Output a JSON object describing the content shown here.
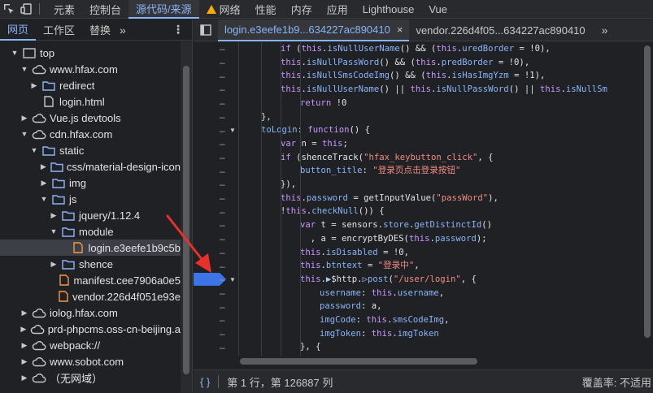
{
  "top_tabs": [
    {
      "label": "元素",
      "icon": null,
      "active": false
    },
    {
      "label": "控制台",
      "icon": null,
      "active": false
    },
    {
      "label": "源代码/来源",
      "icon": null,
      "active": true
    },
    {
      "label": "网络",
      "icon": "warning-icon",
      "active": false
    },
    {
      "label": "性能",
      "icon": null,
      "active": false
    },
    {
      "label": "内存",
      "icon": null,
      "active": false
    },
    {
      "label": "应用",
      "icon": null,
      "active": false
    },
    {
      "label": "Lighthouse",
      "icon": null,
      "active": false
    },
    {
      "label": "Vue",
      "icon": null,
      "active": false
    }
  ],
  "navigator": {
    "tabs": [
      {
        "label": "网页",
        "active": true
      },
      {
        "label": "工作区",
        "active": false
      },
      {
        "label": "替换",
        "active": false
      }
    ],
    "more": "»",
    "menu": "⋮",
    "tree": [
      {
        "label": "top",
        "depth": 0,
        "expand": "open",
        "icon": "frame-icon"
      },
      {
        "label": "www.hfax.com",
        "depth": 1,
        "expand": "open",
        "icon": "cloud-icon"
      },
      {
        "label": "redirect",
        "depth": 2,
        "expand": "closed",
        "icon": "folder-icon"
      },
      {
        "label": "login.html",
        "depth": 2,
        "expand": "none",
        "icon": "document-icon"
      },
      {
        "label": "Vue.js devtools",
        "depth": 1,
        "expand": "closed",
        "icon": "cloud-icon"
      },
      {
        "label": "cdn.hfax.com",
        "depth": 1,
        "expand": "open",
        "icon": "cloud-icon"
      },
      {
        "label": "static",
        "depth": 2,
        "expand": "open",
        "icon": "folder-icon"
      },
      {
        "label": "css/material-design-icon",
        "depth": 3,
        "expand": "closed",
        "icon": "folder-icon"
      },
      {
        "label": "img",
        "depth": 3,
        "expand": "closed",
        "icon": "folder-icon"
      },
      {
        "label": "js",
        "depth": 3,
        "expand": "open",
        "icon": "folder-icon"
      },
      {
        "label": "jquery/1.12.4",
        "depth": 4,
        "expand": "closed",
        "icon": "folder-icon"
      },
      {
        "label": "module",
        "depth": 4,
        "expand": "open",
        "icon": "folder-icon"
      },
      {
        "label": "login.e3eefe1b9c5b",
        "depth": 5,
        "expand": "none",
        "icon": "js-file-icon",
        "selected": true
      },
      {
        "label": "shence",
        "depth": 4,
        "expand": "closed",
        "icon": "folder-icon"
      },
      {
        "label": "manifest.cee7906a0e5",
        "depth": 4,
        "expand": "none",
        "icon": "js-file-icon"
      },
      {
        "label": "vendor.226d4f051e93e",
        "depth": 4,
        "expand": "none",
        "icon": "js-file-icon"
      },
      {
        "label": "iolog.hfax.com",
        "depth": 1,
        "expand": "closed",
        "icon": "cloud-icon"
      },
      {
        "label": "prd-phpcms.oss-cn-beijing.a",
        "depth": 1,
        "expand": "closed",
        "icon": "cloud-icon"
      },
      {
        "label": "webpack://",
        "depth": 1,
        "expand": "closed",
        "icon": "cloud-icon"
      },
      {
        "label": "www.sobot.com",
        "depth": 1,
        "expand": "closed",
        "icon": "cloud-icon"
      },
      {
        "label": "（无网域）",
        "depth": 1,
        "expand": "closed",
        "icon": "cloud-icon"
      }
    ]
  },
  "editor": {
    "tabs": [
      {
        "label": "login.e3eefe1b9...634227ac890410",
        "active": true,
        "closable": true
      },
      {
        "label": "vendor.226d4f05...634227ac890410",
        "active": false,
        "closable": false
      }
    ],
    "more": "»",
    "breakpoint_line": 17,
    "fold_lines": [
      6,
      17,
      23
    ],
    "lines": [
      {
        "indent": 2,
        "html": "<span class='k'>if</span> (<span class='k'>this</span>.<span class='p'>isNullUserName</span>() && (<span class='k'>this</span>.<span class='p'>uredBorder</span> = !0),"
      },
      {
        "indent": 2,
        "html": "<span class='k'>this</span>.<span class='p'>isNullPassWord</span>() && (<span class='k'>this</span>.<span class='p'>predBorder</span> = !0),"
      },
      {
        "indent": 2,
        "html": "<span class='k'>this</span>.<span class='p'>isNullSmsCodeImg</span>() && (<span class='k'>this</span>.<span class='p'>isHasImgYzm</span> = !1),"
      },
      {
        "indent": 2,
        "html": "<span class='k'>this</span>.<span class='p'>isNullUserName</span>() || <span class='k'>this</span>.<span class='p'>isNullPassWord</span>() || <span class='k'>this</span>.<span class='p'>isNullSm</span>"
      },
      {
        "indent": 3,
        "html": "<span class='k'>return</span> !0"
      },
      {
        "indent": 1,
        "html": "},"
      },
      {
        "indent": 1,
        "html": "<span class='p'>toLogin</span>: <span class='k'>function</span>() {"
      },
      {
        "indent": 2,
        "html": "<span class='k'>var</span> n = <span class='k'>this</span>;"
      },
      {
        "indent": 2,
        "html": "<span class='k'>if</span> (shenceTrack(<span class='s'>\"hfax_keybutton_click\"</span>, {"
      },
      {
        "indent": 3,
        "html": "<span class='p'>button_title</span>: <span class='s'>\"登录页点击登录按钮\"</span>"
      },
      {
        "indent": 2,
        "html": "}),"
      },
      {
        "indent": 2,
        "html": "<span class='k'>this</span>.<span class='p'>password</span> = getInputValue(<span class='s'>\"passWord\"</span>),"
      },
      {
        "indent": 2,
        "html": "!<span class='k'>this</span>.<span class='p'>checkNull</span>()) {"
      },
      {
        "indent": 3,
        "html": "<span class='k'>var</span> t = sensors.<span class='p'>store</span>.<span class='p'>getDistinctId</span>()"
      },
      {
        "indent": 3,
        "html": "  , a = encryptByDES(<span class='k'>this</span>.<span class='p'>password</span>);"
      },
      {
        "indent": 3,
        "html": "<span class='k'>this</span>.<span class='p'>isDisabled</span> = !0,"
      },
      {
        "indent": 3,
        "html": "<span class='k'>this</span>.<span class='p'>btntext</span> = <span class='s'>\"登录中\"</span>,"
      },
      {
        "indent": 3,
        "html": "<span class='k'>this</span>.<span class='n'>▶</span>$http.<span class='n'>▷</span><span class='p'>post</span>(<span class='s'>\"/user/login\"</span>, {"
      },
      {
        "indent": 4,
        "html": "<span class='p'>username</span>: <span class='k'>this</span>.<span class='p'>username</span>,"
      },
      {
        "indent": 4,
        "html": "<span class='p'>password</span>: a,"
      },
      {
        "indent": 4,
        "html": "<span class='p'>imgCode</span>: <span class='k'>this</span>.<span class='p'>smsCodeImg</span>,"
      },
      {
        "indent": 4,
        "html": "<span class='p'>imgToken</span>: <span class='k'>this</span>.<span class='p'>imgToken</span>"
      },
      {
        "indent": 3,
        "html": "}, {"
      }
    ]
  },
  "status": {
    "braces": "{ }",
    "position": "第 1 行，第 126887 列",
    "coverage": "覆盖率: 不适用"
  }
}
